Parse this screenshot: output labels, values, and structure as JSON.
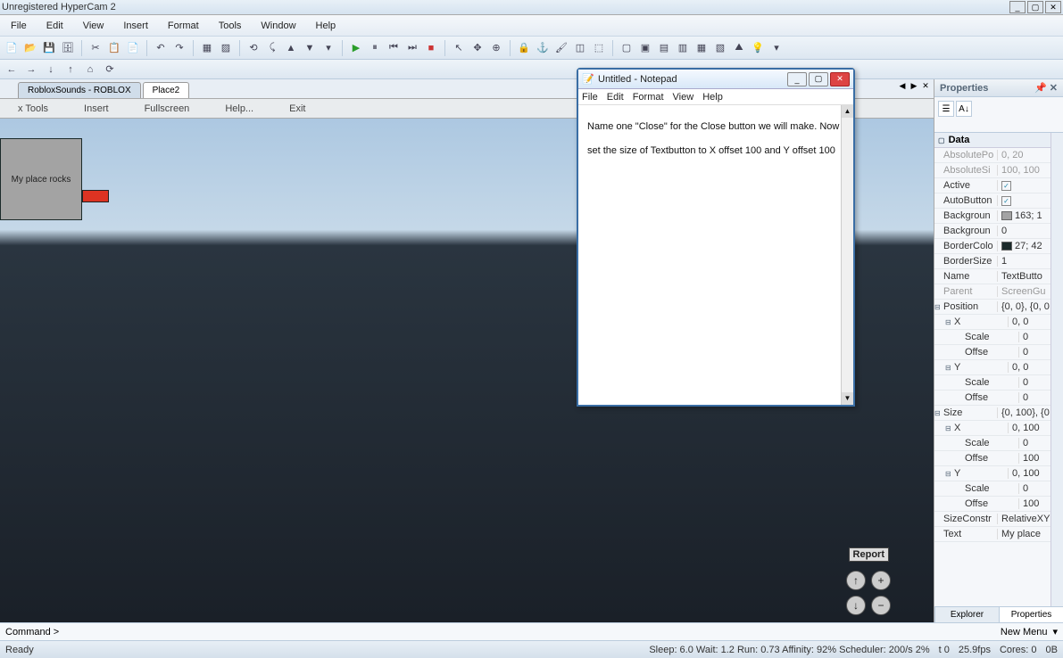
{
  "titlebar": {
    "text": "Unregistered HyperCam 2"
  },
  "window_btns": {
    "min": "_",
    "max": "▢",
    "close": "✕"
  },
  "menubar": [
    "File",
    "Edit",
    "View",
    "Insert",
    "Format",
    "Tools",
    "Window",
    "Help"
  ],
  "doc_tabs": {
    "tab1": "RobloxSounds - ROBLOX",
    "tab2": "Place2"
  },
  "viewport_toolbar": {
    "tools": "x Tools",
    "insert": "Insert",
    "fullscreen": "Fullscreen",
    "help": "Help...",
    "exit": "Exit"
  },
  "gui_text": "My place rocks",
  "report": "Report",
  "notepad": {
    "title": "Untitled - Notepad",
    "menu": [
      "File",
      "Edit",
      "Format",
      "View",
      "Help"
    ],
    "content": "Name one \"Close\" for the Close button we will make. Now set  the size of Textbutton to X offset 100 and Y offset 100"
  },
  "properties": {
    "title": "Properties",
    "category": "Data",
    "rows": {
      "AbsolutePosition": {
        "name": "AbsolutePo",
        "val": "0, 20"
      },
      "AbsoluteSize": {
        "name": "AbsoluteSi",
        "val": "100, 100"
      },
      "Active": {
        "name": "Active",
        "checked": true
      },
      "AutoButton": {
        "name": "AutoButton",
        "checked": true
      },
      "BackgroundColor": {
        "name": "Backgroun",
        "val": "163; 1"
      },
      "BackgroundTransparency": {
        "name": "Backgroun",
        "val": "0"
      },
      "BorderColor": {
        "name": "BorderColo",
        "val": "27; 42"
      },
      "BorderSizePixel": {
        "name": "BorderSize",
        "val": "1"
      },
      "Name": {
        "name": "Name",
        "val": "TextButto"
      },
      "Parent": {
        "name": "Parent",
        "val": "ScreenGu"
      },
      "Position": {
        "name": "Position",
        "val": "{0, 0}, {0, 0"
      },
      "PosX": {
        "name": "X",
        "val": "0, 0"
      },
      "PosXScale": {
        "name": "Scale",
        "val": "0"
      },
      "PosXOffset": {
        "name": "Offse",
        "val": "0"
      },
      "PosY": {
        "name": "Y",
        "val": "0, 0"
      },
      "PosYScale": {
        "name": "Scale",
        "val": "0"
      },
      "PosYOffset": {
        "name": "Offse",
        "val": "0"
      },
      "Size": {
        "name": "Size",
        "val": "{0, 100}, {0"
      },
      "SizeX": {
        "name": "X",
        "val": "0, 100"
      },
      "SizeXScale": {
        "name": "Scale",
        "val": "0"
      },
      "SizeXOffset": {
        "name": "Offse",
        "val": "100"
      },
      "SizeY": {
        "name": "Y",
        "val": "0, 100"
      },
      "SizeYScale": {
        "name": "Scale",
        "val": "0"
      },
      "SizeYOffset": {
        "name": "Offse",
        "val": "100"
      },
      "SizeConstraint": {
        "name": "SizeConstr",
        "val": "RelativeXY"
      },
      "Text": {
        "name": "Text",
        "val": "My place"
      }
    },
    "tabs": {
      "explorer": "Explorer",
      "properties": "Properties"
    }
  },
  "cmd": {
    "label": "Command >",
    "menu": "New Menu"
  },
  "status": {
    "ready": "Ready",
    "perf": "Sleep: 6.0 Wait: 1.2 Run: 0.73 Affinity: 92% Scheduler: 200/s 2%",
    "t": "t 0",
    "fps": "25.9fps",
    "cores": "Cores: 0",
    "mem": "0B"
  }
}
